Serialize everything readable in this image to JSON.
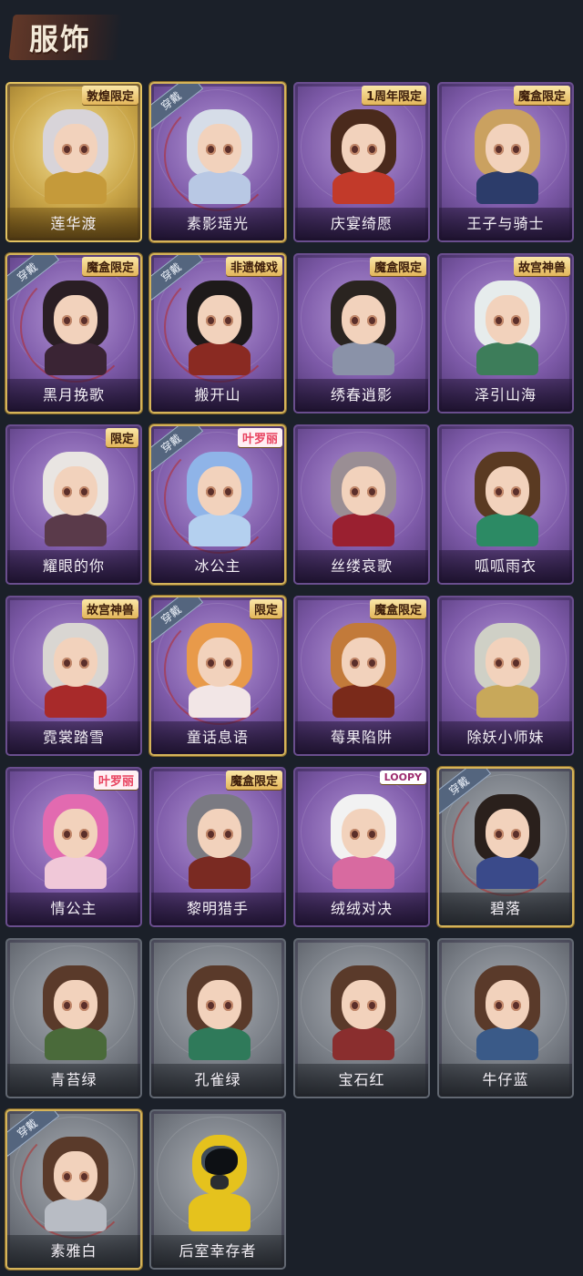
{
  "header": {
    "title": "服饰"
  },
  "outfits": [
    {
      "name": "莲华渡",
      "tier": "gold",
      "equipped": false,
      "tag": "敦煌限定",
      "hair": "#d8d4d9",
      "body": "#c59a3a"
    },
    {
      "name": "素影瑶光",
      "tier": "purple",
      "equipped": true,
      "tag": "",
      "hair": "#d6dde8",
      "body": "#b8c8e4"
    },
    {
      "name": "庆宴绮愿",
      "tier": "purple",
      "equipped": false,
      "tag": "1周年限定",
      "hair": "#4a2a1c",
      "body": "#c23a2a"
    },
    {
      "name": "王子与骑士",
      "tier": "purple",
      "equipped": false,
      "tag": "魔盒限定",
      "hair": "#caa160",
      "body": "#2c3c6a"
    },
    {
      "name": "黑月挽歌",
      "tier": "purple",
      "equipped": true,
      "tag": "魔盒限定",
      "hair": "#2a1e24",
      "body": "#3a2434"
    },
    {
      "name": "搬开山",
      "tier": "purple",
      "equipped": true,
      "tag": "非遗傩戏",
      "hair": "#1e1a1a",
      "body": "#8a2a22"
    },
    {
      "name": "绣春逍影",
      "tier": "purple",
      "equipped": false,
      "tag": "魔盒限定",
      "hair": "#2a2420",
      "body": "#8a92a8"
    },
    {
      "name": "泽引山海",
      "tier": "purple",
      "equipped": false,
      "tag": "故宫神兽",
      "hair": "#e6ecec",
      "body": "#3d7d5a"
    },
    {
      "name": "耀眼的你",
      "tier": "purple",
      "equipped": false,
      "tag": "限定",
      "hair": "#e9e5e2",
      "body": "#5a3a4a"
    },
    {
      "name": "冰公主",
      "tier": "purple",
      "equipped": true,
      "tag": "叶罗丽",
      "hair": "#8fb4e8",
      "body": "#b4d0ef"
    },
    {
      "name": "丝缕哀歌",
      "tier": "purple",
      "equipped": false,
      "tag": "",
      "hair": "#9a8e94",
      "body": "#9a2030"
    },
    {
      "name": "呱呱雨衣",
      "tier": "purple",
      "equipped": false,
      "tag": "",
      "hair": "#5a3a22",
      "body": "#2c8a64"
    },
    {
      "name": "霓裳踏雪",
      "tier": "purple",
      "equipped": false,
      "tag": "故宫神兽",
      "hair": "#d9d6d2",
      "body": "#a82a2a"
    },
    {
      "name": "童话息语",
      "tier": "purple",
      "equipped": true,
      "tag": "限定",
      "hair": "#e89a4a",
      "body": "#f2e6e6"
    },
    {
      "name": "莓果陷阱",
      "tier": "purple",
      "equipped": false,
      "tag": "魔盒限定",
      "hair": "#c27a3a",
      "body": "#7a2a1a"
    },
    {
      "name": "除妖小师妹",
      "tier": "purple",
      "equipped": false,
      "tag": "",
      "hair": "#cfd0c6",
      "body": "#c8a85a"
    },
    {
      "name": "情公主",
      "tier": "purple",
      "equipped": false,
      "tag": "叶罗丽",
      "hair": "#e26ab0",
      "body": "#f0c8d8"
    },
    {
      "name": "黎明猎手",
      "tier": "purple",
      "equipped": false,
      "tag": "魔盒限定",
      "hair": "#7a7a82",
      "body": "#7a2a22"
    },
    {
      "name": "绒绒对决",
      "tier": "purple",
      "equipped": false,
      "tag": "LOOPY",
      "hair": "#f2f2f2",
      "body": "#d86aa0"
    },
    {
      "name": "碧落",
      "tier": "grey",
      "equipped": true,
      "tag": "",
      "hair": "#2a201c",
      "body": "#3a4a8a"
    },
    {
      "name": "青苔绿",
      "tier": "grey",
      "equipped": false,
      "tag": "",
      "hair": "#5a3a2a",
      "body": "#4a6a3a"
    },
    {
      "name": "孔雀绿",
      "tier": "grey",
      "equipped": false,
      "tag": "",
      "hair": "#5a3a2a",
      "body": "#2f7a5a"
    },
    {
      "name": "宝石红",
      "tier": "grey",
      "equipped": false,
      "tag": "",
      "hair": "#5a3a2a",
      "body": "#8a2e2e"
    },
    {
      "name": "牛仔蓝",
      "tier": "grey",
      "equipped": false,
      "tag": "",
      "hair": "#5a3a2a",
      "body": "#3a5a88"
    },
    {
      "name": "素雅白",
      "tier": "grey",
      "equipped": true,
      "tag": "",
      "hair": "#5a3a2a",
      "body": "#b8bcc4"
    },
    {
      "name": "后室幸存者",
      "tier": "grey",
      "equipped": false,
      "tag": "",
      "hazmat": true
    }
  ],
  "labels": {
    "equipped": "穿戴"
  }
}
